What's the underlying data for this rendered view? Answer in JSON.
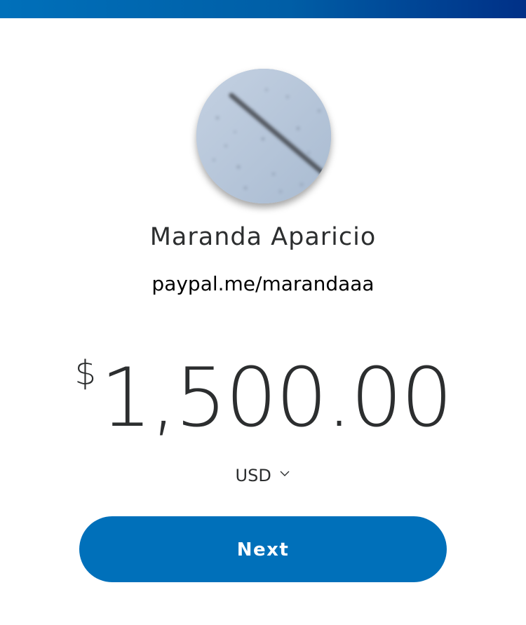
{
  "recipient": {
    "name": "Maranda Aparicio",
    "handle": "paypal.me/marandaaa",
    "avatar_icon": "profile-photo"
  },
  "payment": {
    "currency_symbol": "$",
    "amount": "1,500.00",
    "currency_code": "USD"
  },
  "actions": {
    "next_label": "Next"
  },
  "colors": {
    "brand_blue": "#0070ba",
    "header_dark_blue": "#003087",
    "text_dark": "#2c2e2f"
  }
}
